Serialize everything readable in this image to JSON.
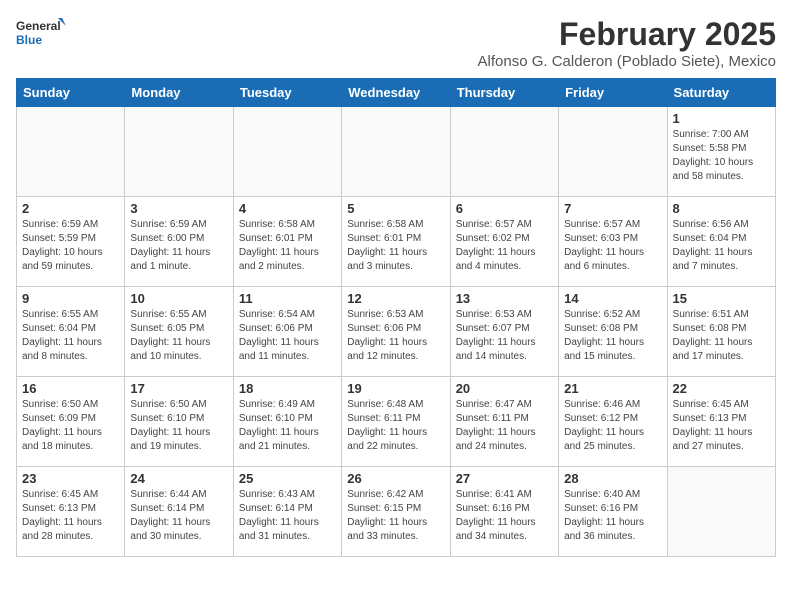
{
  "header": {
    "logo_line1": "General",
    "logo_line2": "Blue",
    "month_year": "February 2025",
    "location": "Alfonso G. Calderon (Poblado Siete), Mexico"
  },
  "weekdays": [
    "Sunday",
    "Monday",
    "Tuesday",
    "Wednesday",
    "Thursday",
    "Friday",
    "Saturday"
  ],
  "weeks": [
    [
      {
        "day": "",
        "info": ""
      },
      {
        "day": "",
        "info": ""
      },
      {
        "day": "",
        "info": ""
      },
      {
        "day": "",
        "info": ""
      },
      {
        "day": "",
        "info": ""
      },
      {
        "day": "",
        "info": ""
      },
      {
        "day": "1",
        "info": "Sunrise: 7:00 AM\nSunset: 5:58 PM\nDaylight: 10 hours\nand 58 minutes."
      }
    ],
    [
      {
        "day": "2",
        "info": "Sunrise: 6:59 AM\nSunset: 5:59 PM\nDaylight: 10 hours\nand 59 minutes."
      },
      {
        "day": "3",
        "info": "Sunrise: 6:59 AM\nSunset: 6:00 PM\nDaylight: 11 hours\nand 1 minute."
      },
      {
        "day": "4",
        "info": "Sunrise: 6:58 AM\nSunset: 6:01 PM\nDaylight: 11 hours\nand 2 minutes."
      },
      {
        "day": "5",
        "info": "Sunrise: 6:58 AM\nSunset: 6:01 PM\nDaylight: 11 hours\nand 3 minutes."
      },
      {
        "day": "6",
        "info": "Sunrise: 6:57 AM\nSunset: 6:02 PM\nDaylight: 11 hours\nand 4 minutes."
      },
      {
        "day": "7",
        "info": "Sunrise: 6:57 AM\nSunset: 6:03 PM\nDaylight: 11 hours\nand 6 minutes."
      },
      {
        "day": "8",
        "info": "Sunrise: 6:56 AM\nSunset: 6:04 PM\nDaylight: 11 hours\nand 7 minutes."
      }
    ],
    [
      {
        "day": "9",
        "info": "Sunrise: 6:55 AM\nSunset: 6:04 PM\nDaylight: 11 hours\nand 8 minutes."
      },
      {
        "day": "10",
        "info": "Sunrise: 6:55 AM\nSunset: 6:05 PM\nDaylight: 11 hours\nand 10 minutes."
      },
      {
        "day": "11",
        "info": "Sunrise: 6:54 AM\nSunset: 6:06 PM\nDaylight: 11 hours\nand 11 minutes."
      },
      {
        "day": "12",
        "info": "Sunrise: 6:53 AM\nSunset: 6:06 PM\nDaylight: 11 hours\nand 12 minutes."
      },
      {
        "day": "13",
        "info": "Sunrise: 6:53 AM\nSunset: 6:07 PM\nDaylight: 11 hours\nand 14 minutes."
      },
      {
        "day": "14",
        "info": "Sunrise: 6:52 AM\nSunset: 6:08 PM\nDaylight: 11 hours\nand 15 minutes."
      },
      {
        "day": "15",
        "info": "Sunrise: 6:51 AM\nSunset: 6:08 PM\nDaylight: 11 hours\nand 17 minutes."
      }
    ],
    [
      {
        "day": "16",
        "info": "Sunrise: 6:50 AM\nSunset: 6:09 PM\nDaylight: 11 hours\nand 18 minutes."
      },
      {
        "day": "17",
        "info": "Sunrise: 6:50 AM\nSunset: 6:10 PM\nDaylight: 11 hours\nand 19 minutes."
      },
      {
        "day": "18",
        "info": "Sunrise: 6:49 AM\nSunset: 6:10 PM\nDaylight: 11 hours\nand 21 minutes."
      },
      {
        "day": "19",
        "info": "Sunrise: 6:48 AM\nSunset: 6:11 PM\nDaylight: 11 hours\nand 22 minutes."
      },
      {
        "day": "20",
        "info": "Sunrise: 6:47 AM\nSunset: 6:11 PM\nDaylight: 11 hours\nand 24 minutes."
      },
      {
        "day": "21",
        "info": "Sunrise: 6:46 AM\nSunset: 6:12 PM\nDaylight: 11 hours\nand 25 minutes."
      },
      {
        "day": "22",
        "info": "Sunrise: 6:45 AM\nSunset: 6:13 PM\nDaylight: 11 hours\nand 27 minutes."
      }
    ],
    [
      {
        "day": "23",
        "info": "Sunrise: 6:45 AM\nSunset: 6:13 PM\nDaylight: 11 hours\nand 28 minutes."
      },
      {
        "day": "24",
        "info": "Sunrise: 6:44 AM\nSunset: 6:14 PM\nDaylight: 11 hours\nand 30 minutes."
      },
      {
        "day": "25",
        "info": "Sunrise: 6:43 AM\nSunset: 6:14 PM\nDaylight: 11 hours\nand 31 minutes."
      },
      {
        "day": "26",
        "info": "Sunrise: 6:42 AM\nSunset: 6:15 PM\nDaylight: 11 hours\nand 33 minutes."
      },
      {
        "day": "27",
        "info": "Sunrise: 6:41 AM\nSunset: 6:16 PM\nDaylight: 11 hours\nand 34 minutes."
      },
      {
        "day": "28",
        "info": "Sunrise: 6:40 AM\nSunset: 6:16 PM\nDaylight: 11 hours\nand 36 minutes."
      },
      {
        "day": "",
        "info": ""
      }
    ]
  ]
}
